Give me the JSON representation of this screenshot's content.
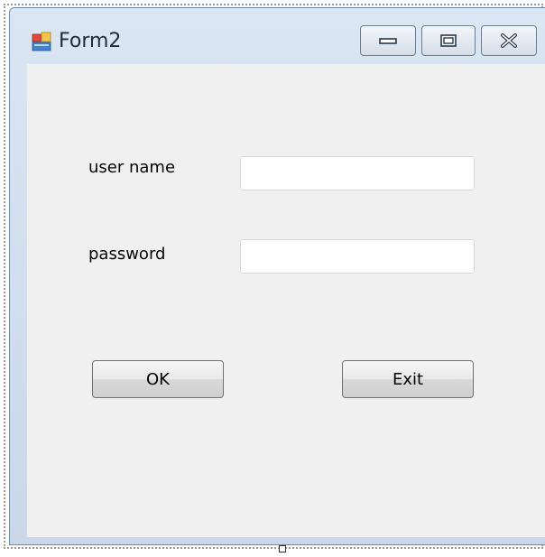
{
  "window": {
    "title": "Form2",
    "icon": "form-icon",
    "controls": {
      "minimize": "minimize-icon",
      "maximize": "maximize-icon",
      "close": "close-icon"
    }
  },
  "form": {
    "username_label": "user name",
    "username_value": "",
    "password_label": "password",
    "password_value": "",
    "ok_label": "OK",
    "exit_label": "Exit"
  }
}
